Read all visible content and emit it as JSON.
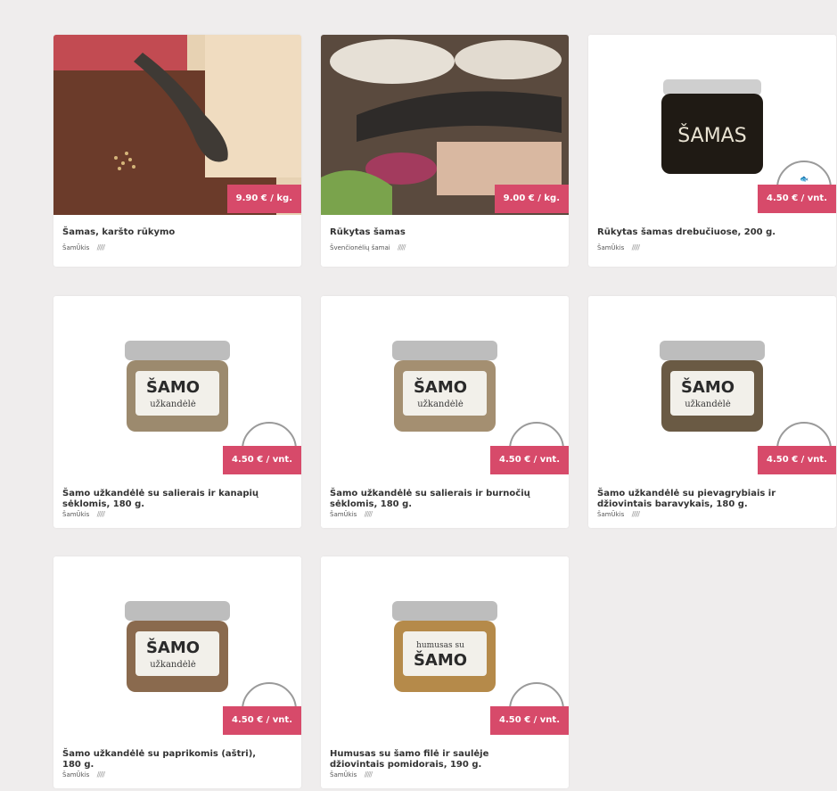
{
  "products": [
    {
      "title": "Šamas, karšto rūkymo",
      "seller": "ŠamŪkis",
      "price": "9.90 € / kg.",
      "rating": "/////"
    },
    {
      "title": "Rūkytas šamas",
      "seller": "Švenčionėlių šamai",
      "price": "9.00 € / kg.",
      "rating": "/////"
    },
    {
      "title": "Rūkytas šamas drebučiuose, 200 g.",
      "seller": "ŠamŪkis",
      "price": "4.50 € / vnt.",
      "rating": "/////",
      "jar_text": "ŠAMAS"
    },
    {
      "title": "Šamo užkandėlė su salierais ir kanapių sėklomis, 180 g.",
      "seller": "ŠamŪkis",
      "price": "4.50 € / vnt.",
      "rating": "/////",
      "jar_text": "ŠAMO",
      "jar_sub": "užkandėlė"
    },
    {
      "title": "Šamo užkandėlė su salierais ir burnočių sėklomis, 180 g.",
      "seller": "ŠamŪkis",
      "price": "4.50 € / vnt.",
      "rating": "/////",
      "jar_text": "ŠAMO",
      "jar_sub": "užkandėlė"
    },
    {
      "title": "Šamo užkandėlė su pievagrybiais ir džiovintais baravykais, 180 g.",
      "seller": "ŠamŪkis",
      "price": "4.50 € / vnt.",
      "rating": "/////",
      "jar_text": "ŠAMO",
      "jar_sub": "užkandėlė"
    },
    {
      "title": "Šamo užkandėlė su paprikomis (aštri), 180 g.",
      "seller": "ŠamŪkis",
      "price": "4.50 € / vnt.",
      "rating": "/////",
      "jar_text": "ŠAMO",
      "jar_sub": "užkandėlė"
    },
    {
      "title": "Humusas su šamo filė ir saulėje džiovintais pomidorais, 190 g.",
      "seller": "ŠamŪkis",
      "price": "4.50 € / vnt.",
      "rating": "/////",
      "jar_text": "ŠAMO",
      "jar_sub": "humusas su"
    }
  ],
  "colors": {
    "price_bg": "#d74a6a",
    "page_bg": "#efeded"
  }
}
